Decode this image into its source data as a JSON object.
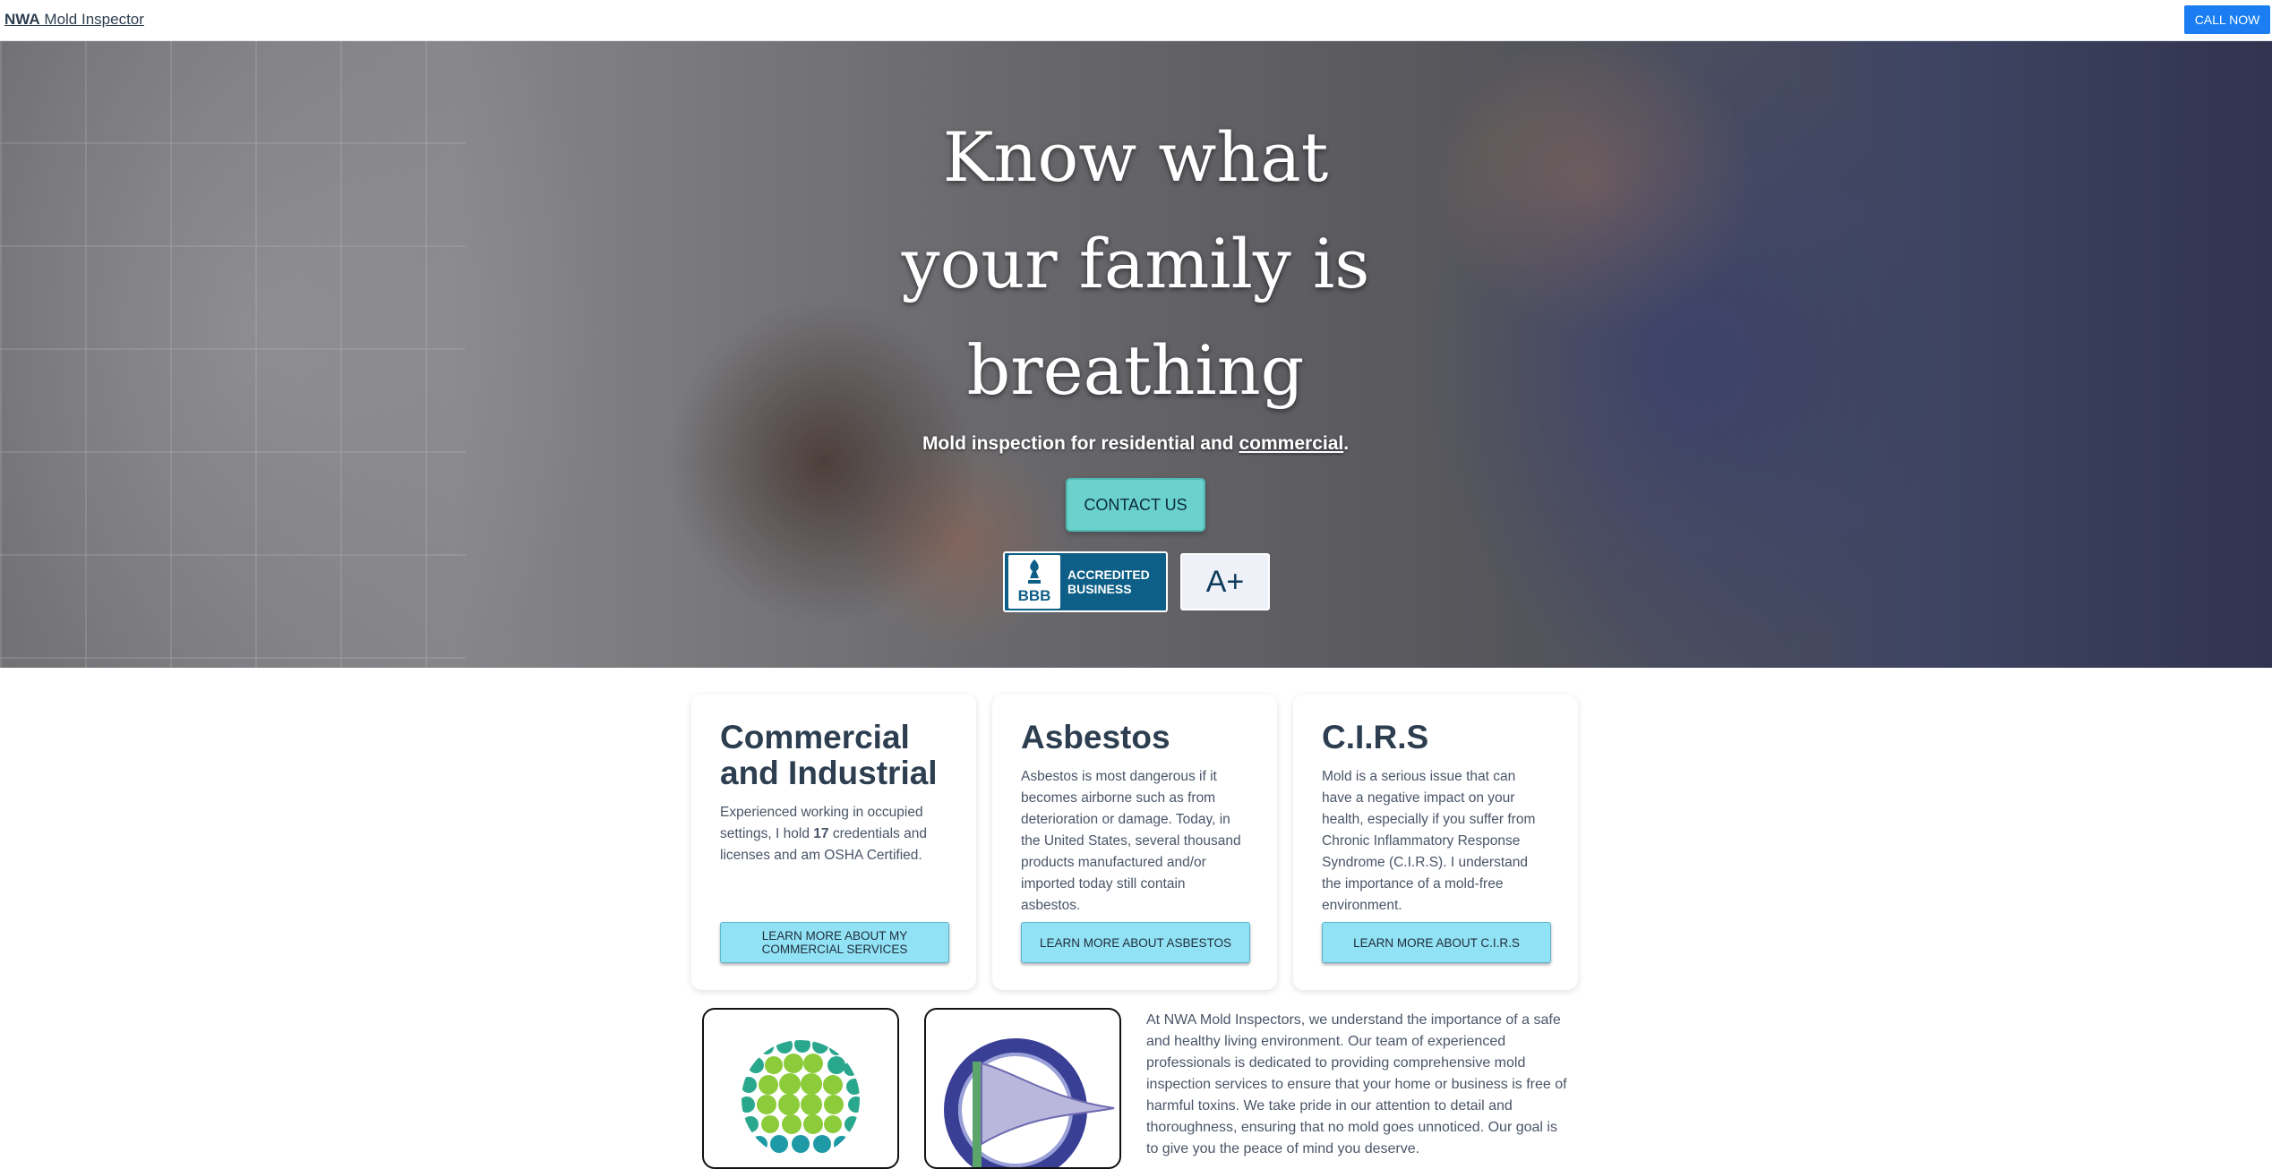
{
  "nav": {
    "brand_bold": "NWA",
    "brand_rest": "Mold Inspector",
    "call_label": "CALL NOW"
  },
  "hero": {
    "title_line1": "Know what",
    "title_line2": "your family is",
    "title_line3": "breathing",
    "subtitle_prefix": "Mold inspection for residential and",
    "subtitle_link": "commercial",
    "subtitle_suffix": ".",
    "contact_label": "CONTACT US",
    "bbb_mark": "BBB",
    "bbb_line1": "ACCREDITED",
    "bbb_line2": "BUSINESS",
    "rating": "A+"
  },
  "cards": [
    {
      "title": "Commercial and Industrial",
      "text_before": "Experienced working in occupied settings, I hold ",
      "text_bold": "17",
      "text_after": " credentials and licenses and am OSHA Certified.",
      "button": "LEARN MORE ABOUT MY COMMERCIAL SERVICES"
    },
    {
      "title": "Asbestos",
      "text": "Asbestos is most dangerous if it becomes airborne such as from deterioration or damage. Today, in the United States, several thousand products manufactured and/or imported today still contain asbestos.",
      "button": "LEARN MORE ABOUT ASBESTOS"
    },
    {
      "title": "C.I.R.S",
      "text": "Mold is a serious issue that can have a negative impact on your health, especially if you suffer from Chronic Inflammatory Response Syndrome (C.I.R.S). I understand the importance of a mold-free environment.",
      "button": "LEARN MORE ABOUT C.I.R.S"
    }
  ],
  "about": {
    "text": "At NWA Mold Inspectors, we understand the importance of a safe and healthy living environment. Our team of experienced professionals is dedicated to providing comprehensive mold inspection services to ensure that your home or business is free of harmful toxins. We take pride in our attention to detail and thoroughness, ensuring that no mold goes unnoticed. Our goal is to give you the peace of mind you deserve."
  },
  "colors": {
    "nav_button": "#1a7ef2",
    "contact_button": "#6ad1cc",
    "card_button": "#92e2f5",
    "bbb_blue": "#0e5f87",
    "heading": "#2c3e50"
  },
  "icons": {
    "bbb": "bbb-torch-icon",
    "logo1": "sphere-dots-logo",
    "logo2": "flag-circle-logo"
  }
}
